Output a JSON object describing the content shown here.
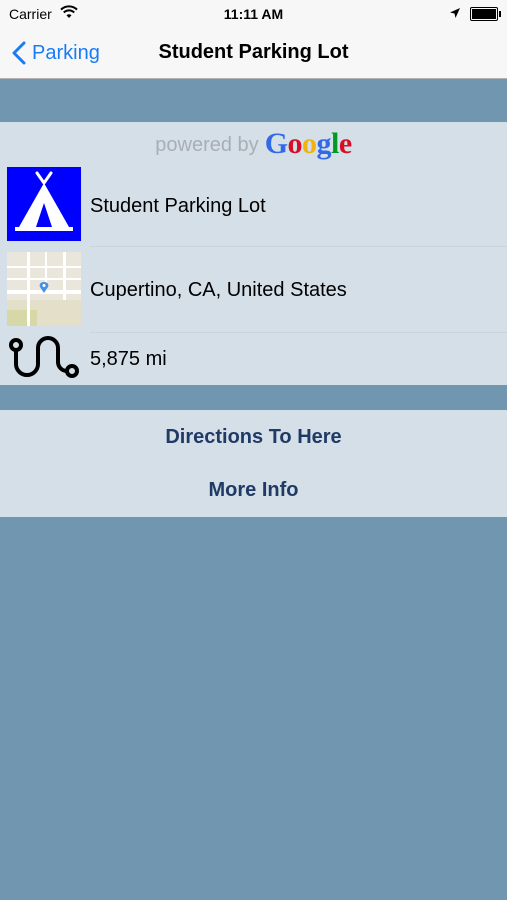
{
  "status_bar": {
    "carrier": "Carrier",
    "time": "11:11 AM"
  },
  "nav": {
    "back_label": "Parking",
    "title": "Student Parking Lot"
  },
  "attribution": {
    "prefix": "powered by",
    "brand_letters": [
      "G",
      "o",
      "o",
      "g",
      "l",
      "e"
    ],
    "brand_colors": [
      "#3369e8",
      "#d50f25",
      "#eeb211",
      "#3369e8",
      "#009925",
      "#d50f25"
    ]
  },
  "details": {
    "name": "Student Parking Lot",
    "address": "Cupertino, CA, United States",
    "distance": "5,875 mi"
  },
  "actions": {
    "directions": "Directions To Here",
    "more_info": "More Info"
  },
  "colors": {
    "accent": "#1a7cf5",
    "background": "#7096b0",
    "card": "#d5dfe8",
    "action_text": "#203a66",
    "icon_blue": "#0000ff"
  }
}
